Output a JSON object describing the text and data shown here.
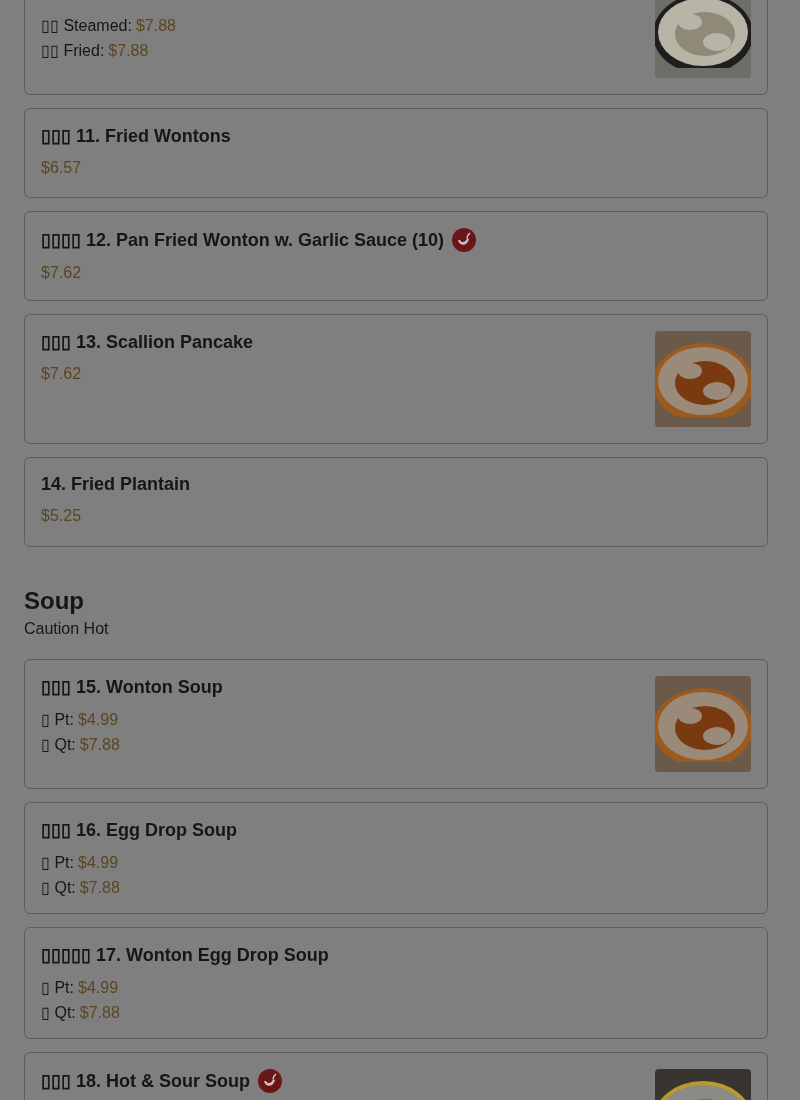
{
  "sections": [
    {
      "items": [
        {
          "prices": [
            {
              "label": "▯▯ Steamed:",
              "price": "$7.88"
            },
            {
              "label": "▯▯ Fried:",
              "price": "$7.88"
            }
          ],
          "photo": {
            "kind": "picture"
          }
        },
        {
          "title": "▯▯▯ 11. Fried Wontons",
          "prices": [
            {
              "price": "$6.57"
            }
          ]
        },
        {
          "title": "▯▯▯▯ 12. Pan Fried Wonton w. Garlic Sauce (10)",
          "prices": [
            {
              "price": "$7.62"
            }
          ],
          "spicy": true
        },
        {
          "title": "▯▯▯ 13. Scallion Pancake",
          "prices": [
            {
              "price": "$7.62"
            }
          ],
          "photo": {
            "kind": "picture"
          }
        },
        {
          "title": "14. Fried Plantain",
          "prices": [
            {
              "price": "$5.25"
            }
          ]
        }
      ]
    },
    {
      "heading": "Soup",
      "note": "Caution Hot",
      "items": [
        {
          "title": "▯▯▯ 15. Wonton Soup",
          "prices": [
            {
              "label": "▯ Pt:",
              "price": "$4.99"
            },
            {
              "label": "▯ Qt:",
              "price": "$7.88"
            }
          ],
          "photo": {
            "kind": "picture"
          }
        },
        {
          "title": "▯▯▯ 16. Egg Drop Soup",
          "prices": [
            {
              "label": "▯ Pt:",
              "price": "$4.99"
            },
            {
              "label": "▯ Qt:",
              "price": "$7.88"
            }
          ]
        },
        {
          "title": "▯▯▯▯▯ 17. Wonton Egg Drop Soup",
          "prices": [
            {
              "label": "▯ Pt:",
              "price": "$4.99"
            },
            {
              "label": "▯ Qt:",
              "price": "$7.88"
            }
          ]
        },
        {
          "title": "▯▯▯ 18. Hot & Sour Soup",
          "spicy": true,
          "photo": {
            "kind": "picture"
          }
        }
      ]
    }
  ]
}
